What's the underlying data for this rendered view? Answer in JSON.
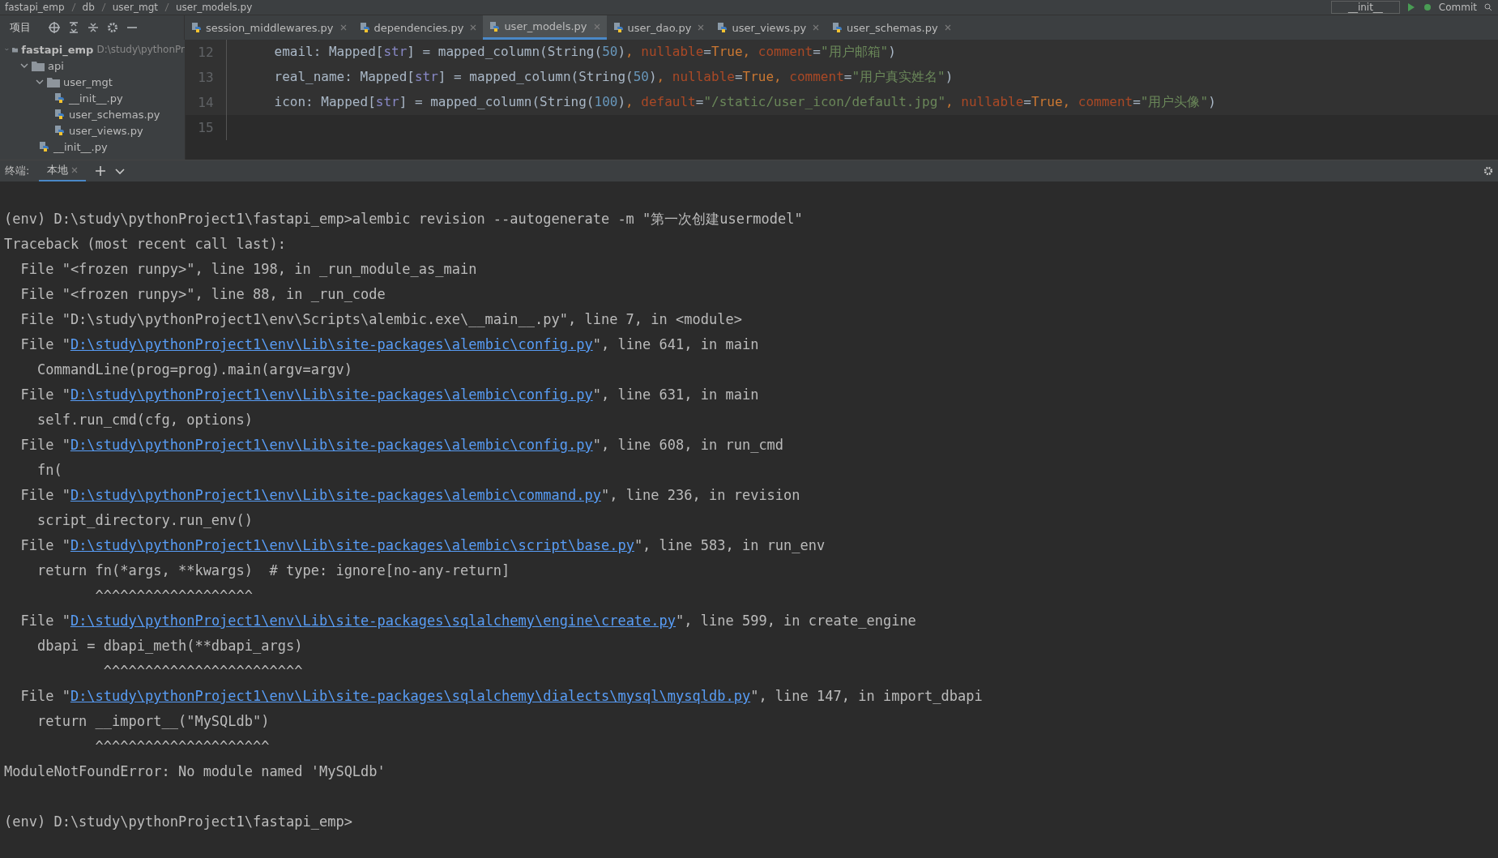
{
  "breadcrumb": [
    "fastapi_emp",
    "db",
    "user_mgt",
    "user_models.py"
  ],
  "toolbar": {
    "run_config": "__init__",
    "commit": "Commit"
  },
  "project_panel": {
    "title": "项目"
  },
  "tree": [
    {
      "name": "fastapi_emp",
      "path": "D:\\study\\pythonPr",
      "kind": "folder",
      "expanded": true,
      "children": [
        {
          "name": "api",
          "kind": "folder",
          "expanded": true,
          "children": [
            {
              "name": "user_mgt",
              "kind": "folder",
              "expanded": true,
              "children": [
                {
                  "name": "__init__.py",
                  "kind": "file"
                },
                {
                  "name": "user_schemas.py",
                  "kind": "file"
                },
                {
                  "name": "user_views.py",
                  "kind": "file"
                }
              ]
            },
            {
              "name": "__init__.py",
              "kind": "file"
            }
          ]
        }
      ]
    }
  ],
  "tabs": [
    {
      "label": "session_middlewares.py",
      "selected": false
    },
    {
      "label": "dependencies.py",
      "selected": false
    },
    {
      "label": "user_models.py",
      "selected": true
    },
    {
      "label": "user_dao.py",
      "selected": false
    },
    {
      "label": "user_views.py",
      "selected": false
    },
    {
      "label": "user_schemas.py",
      "selected": false
    }
  ],
  "editor": {
    "lines": [
      {
        "number": "12",
        "tokens": [
          {
            "kind": "plain",
            "text": "    email: Mapped["
          },
          {
            "kind": "builtin",
            "text": "str"
          },
          {
            "kind": "plain",
            "text": "] = mapped_column(String("
          },
          {
            "kind": "number",
            "text": "50"
          },
          {
            "kind": "plain",
            "text": ")"
          },
          {
            "kind": "keyword",
            "text": ", "
          },
          {
            "kind": "param",
            "text": "nullable"
          },
          {
            "kind": "plain",
            "text": "="
          },
          {
            "kind": "keyword",
            "text": "True, "
          },
          {
            "kind": "param",
            "text": "comment"
          },
          {
            "kind": "plain",
            "text": "="
          },
          {
            "kind": "string",
            "text": "\"用户邮箱\""
          },
          {
            "kind": "plain",
            "text": ")"
          }
        ]
      },
      {
        "number": "13",
        "tokens": [
          {
            "kind": "plain",
            "text": "    real_name: Mapped["
          },
          {
            "kind": "builtin",
            "text": "str"
          },
          {
            "kind": "plain",
            "text": "] = mapped_column(String("
          },
          {
            "kind": "number",
            "text": "50"
          },
          {
            "kind": "plain",
            "text": ")"
          },
          {
            "kind": "keyword",
            "text": ", "
          },
          {
            "kind": "param",
            "text": "nullable"
          },
          {
            "kind": "plain",
            "text": "="
          },
          {
            "kind": "keyword",
            "text": "True, "
          },
          {
            "kind": "param",
            "text": "comment"
          },
          {
            "kind": "plain",
            "text": "="
          },
          {
            "kind": "string",
            "text": "\"用户真实姓名\""
          },
          {
            "kind": "plain",
            "text": ")"
          }
        ]
      },
      {
        "number": "14",
        "tokens": [
          {
            "kind": "plain",
            "text": "    icon: Mapped["
          },
          {
            "kind": "builtin",
            "text": "str"
          },
          {
            "kind": "plain",
            "text": "] = mapped_column(String("
          },
          {
            "kind": "number",
            "text": "100"
          },
          {
            "kind": "plain",
            "text": ")"
          },
          {
            "kind": "keyword",
            "text": ", "
          },
          {
            "kind": "param",
            "text": "default"
          },
          {
            "kind": "plain",
            "text": "="
          },
          {
            "kind": "string",
            "text": "\"/static/user_icon/default.jpg\""
          },
          {
            "kind": "keyword",
            "text": ", "
          },
          {
            "kind": "param",
            "text": "nullable"
          },
          {
            "kind": "plain",
            "text": "="
          },
          {
            "kind": "keyword",
            "text": "True, "
          },
          {
            "kind": "param",
            "text": "comment"
          },
          {
            "kind": "plain",
            "text": "="
          },
          {
            "kind": "string",
            "text": "\"用户头像\""
          },
          {
            "kind": "plain",
            "text": ")"
          }
        ]
      },
      {
        "number": "15"
      }
    ]
  },
  "terminal": {
    "label": "终端:",
    "tabs": [
      {
        "label": "本地",
        "selected": true
      }
    ],
    "lines": [
      {
        "kind": "blank"
      },
      {
        "kind": "text",
        "text": "(env) D:\\study\\pythonProject1\\fastapi_emp>alembic revision --autogenerate -m \"第一次创建usermodel\""
      },
      {
        "kind": "text",
        "text": "Traceback (most recent call last):"
      },
      {
        "kind": "text",
        "text": "  File \"<frozen runpy>\", line 198, in _run_module_as_main"
      },
      {
        "kind": "text",
        "text": "  File \"<frozen runpy>\", line 88, in _run_code"
      },
      {
        "kind": "text",
        "text": "  File \"D:\\study\\pythonProject1\\env\\Scripts\\alembic.exe\\__main__.py\", line 7, in <module>"
      },
      {
        "kind": "file",
        "before": "  File \"",
        "link": "D:\\study\\pythonProject1\\env\\Lib\\site-packages\\alembic\\config.py",
        "after": "\", line 641, in main"
      },
      {
        "kind": "text",
        "text": "    CommandLine(prog=prog).main(argv=argv)"
      },
      {
        "kind": "file",
        "before": "  File \"",
        "link": "D:\\study\\pythonProject1\\env\\Lib\\site-packages\\alembic\\config.py",
        "after": "\", line 631, in main"
      },
      {
        "kind": "text",
        "text": "    self.run_cmd(cfg, options)"
      },
      {
        "kind": "file",
        "before": "  File \"",
        "link": "D:\\study\\pythonProject1\\env\\Lib\\site-packages\\alembic\\config.py",
        "after": "\", line 608, in run_cmd"
      },
      {
        "kind": "text",
        "text": "    fn("
      },
      {
        "kind": "file",
        "before": "  File \"",
        "link": "D:\\study\\pythonProject1\\env\\Lib\\site-packages\\alembic\\command.py",
        "after": "\", line 236, in revision"
      },
      {
        "kind": "text",
        "text": "    script_directory.run_env()"
      },
      {
        "kind": "file",
        "before": "  File \"",
        "link": "D:\\study\\pythonProject1\\env\\Lib\\site-packages\\alembic\\script\\base.py",
        "after": "\", line 583, in run_env"
      },
      {
        "kind": "text",
        "text": "    return fn(*args, **kwargs)  # type: ignore[no-any-return]"
      },
      {
        "kind": "text",
        "text": "           ^^^^^^^^^^^^^^^^^^^"
      },
      {
        "kind": "file",
        "before": "  File \"",
        "link": "D:\\study\\pythonProject1\\env\\Lib\\site-packages\\sqlalchemy\\engine\\create.py",
        "after": "\", line 599, in create_engine"
      },
      {
        "kind": "text",
        "text": "    dbapi = dbapi_meth(**dbapi_args)"
      },
      {
        "kind": "text",
        "text": "            ^^^^^^^^^^^^^^^^^^^^^^^^"
      },
      {
        "kind": "file",
        "before": "  File \"",
        "link": "D:\\study\\pythonProject1\\env\\Lib\\site-packages\\sqlalchemy\\dialects\\mysql\\mysqldb.py",
        "after": "\", line 147, in import_dbapi"
      },
      {
        "kind": "text",
        "text": "    return __import__(\"MySQLdb\")"
      },
      {
        "kind": "text",
        "text": "           ^^^^^^^^^^^^^^^^^^^^^"
      },
      {
        "kind": "text",
        "text": "ModuleNotFoundError: No module named 'MySQLdb'"
      },
      {
        "kind": "blank"
      },
      {
        "kind": "text",
        "text": "(env) D:\\study\\pythonProject1\\fastapi_emp>"
      }
    ]
  }
}
